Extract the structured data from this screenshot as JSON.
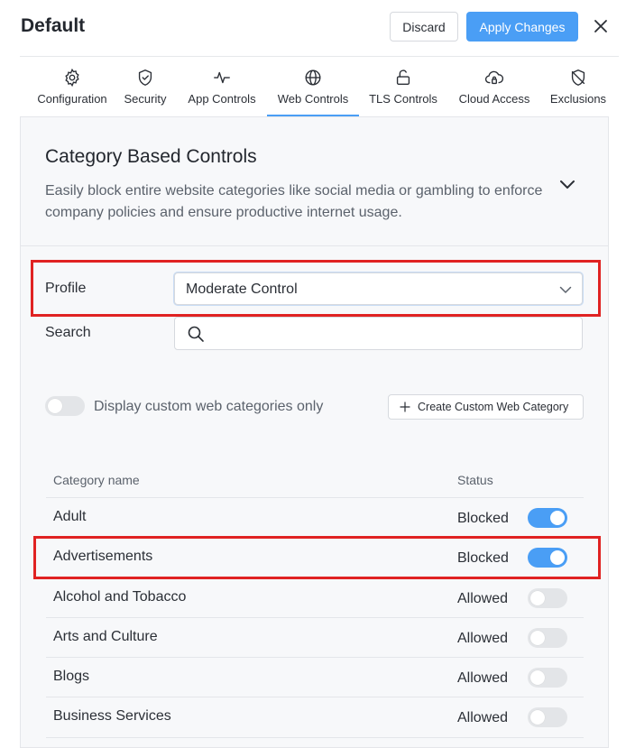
{
  "header": {
    "title": "Default",
    "discard_label": "Discard",
    "apply_label": "Apply Changes"
  },
  "tabs": [
    {
      "label": "Configuration",
      "icon": "gear-icon"
    },
    {
      "label": "Security",
      "icon": "shield-check-icon"
    },
    {
      "label": "App Controls",
      "icon": "activity-icon"
    },
    {
      "label": "Web Controls",
      "icon": "globe-icon",
      "active": true
    },
    {
      "label": "TLS Controls",
      "icon": "unlock-icon"
    },
    {
      "label": "Cloud Access",
      "icon": "cloud-lock-icon"
    },
    {
      "label": "Exclusions",
      "icon": "shield-off-icon"
    }
  ],
  "section": {
    "title": "Category Based Controls",
    "description": "Easily block entire website categories like social media or gambling to enforce company policies and ensure productive internet usage."
  },
  "form": {
    "profile_label": "Profile",
    "profile_value": "Moderate Control",
    "search_label": "Search",
    "search_value": "",
    "custom_only_label": "Display custom web categories only",
    "custom_only_enabled": false,
    "create_button_label": "Create Custom Web Category"
  },
  "table": {
    "col_name": "Category name",
    "col_status": "Status",
    "rows": [
      {
        "name": "Adult",
        "status": "Blocked",
        "enabled": true
      },
      {
        "name": "Advertisements",
        "status": "Blocked",
        "enabled": true
      },
      {
        "name": "Alcohol and Tobacco",
        "status": "Allowed",
        "enabled": false
      },
      {
        "name": "Arts and Culture",
        "status": "Allowed",
        "enabled": false
      },
      {
        "name": "Blogs",
        "status": "Allowed",
        "enabled": false
      },
      {
        "name": "Business Services",
        "status": "Allowed",
        "enabled": false
      }
    ]
  },
  "colors": {
    "accent": "#4a9ef5",
    "highlight": "#e02222",
    "toggle_off": "#e3e5e8"
  }
}
